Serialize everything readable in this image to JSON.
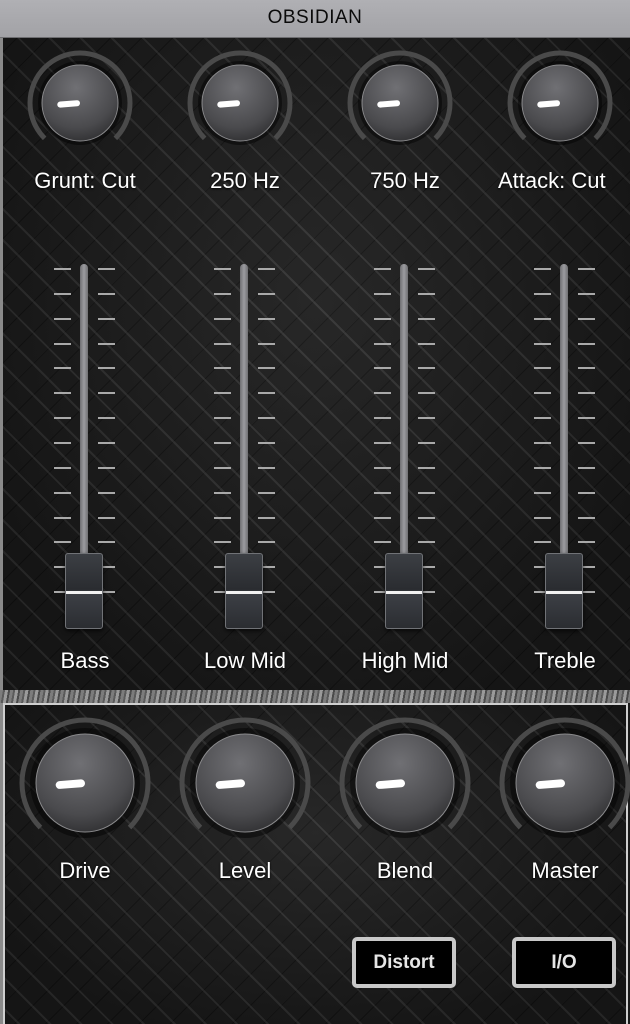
{
  "app": {
    "title": "OBSIDIAN"
  },
  "top_knobs": [
    {
      "name": "grunt",
      "label": "Grunt: Cut",
      "value": 0.15
    },
    {
      "name": "250hz",
      "label": "250 Hz",
      "value": 0.15
    },
    {
      "name": "750hz",
      "label": "750 Hz",
      "value": 0.15
    },
    {
      "name": "attack",
      "label": "Attack: Cut",
      "value": 0.15
    }
  ],
  "sliders": [
    {
      "name": "bass",
      "label": "Bass",
      "value": 0.0
    },
    {
      "name": "low-mid",
      "label": "Low Mid",
      "value": 0.0
    },
    {
      "name": "high-mid",
      "label": "High Mid",
      "value": 0.0
    },
    {
      "name": "treble",
      "label": "Treble",
      "value": 0.0
    }
  ],
  "bottom_knobs": [
    {
      "name": "drive",
      "label": "Drive",
      "value": 0.15
    },
    {
      "name": "level",
      "label": "Level",
      "value": 0.15
    },
    {
      "name": "blend",
      "label": "Blend",
      "value": 0.15
    },
    {
      "name": "master",
      "label": "Master",
      "value": 0.15
    }
  ],
  "buttons": {
    "distort": "Distort",
    "io": "I/O"
  },
  "colors": {
    "header": "#a8a8ac",
    "knob_indicator": "#ffffff",
    "button_border": "#c8c8c8"
  }
}
